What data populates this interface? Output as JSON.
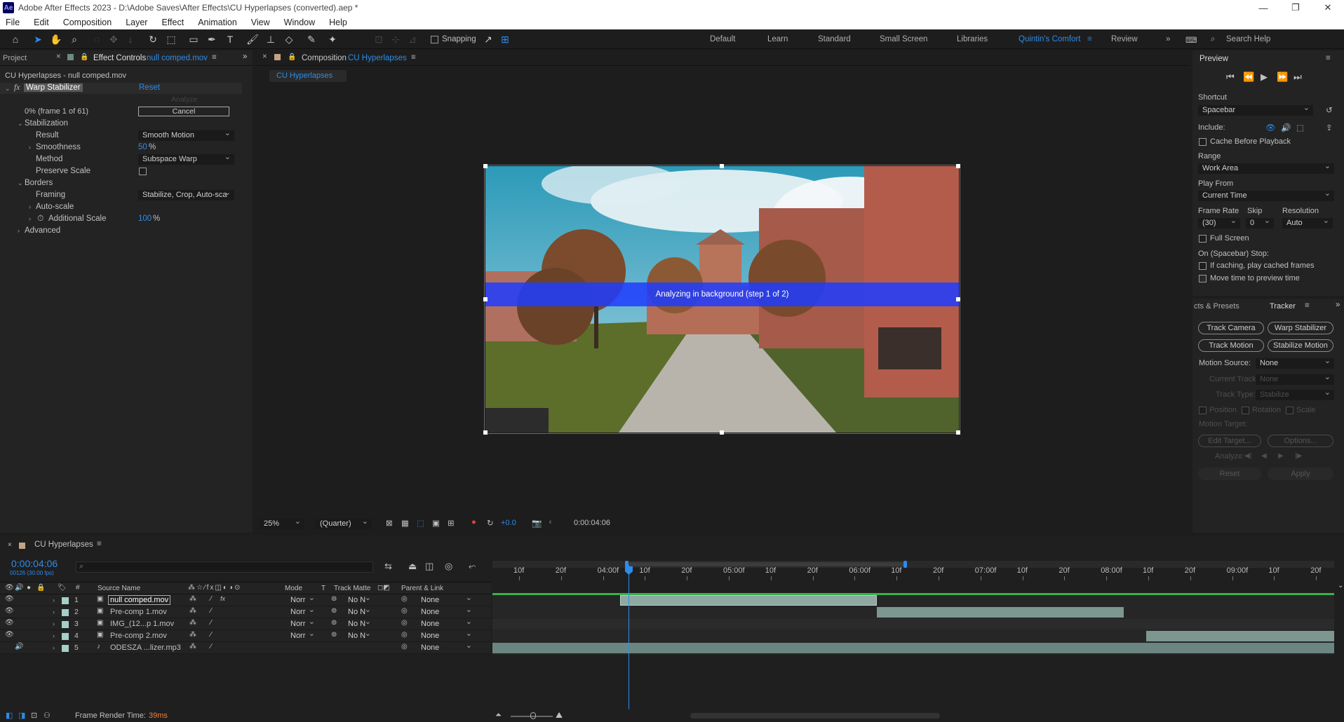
{
  "app": {
    "title": "Adobe After Effects 2023 - D:\\Adobe Saves\\After Effects\\CU Hyperlapses (converted).aep *",
    "logo": "Ae"
  },
  "menu": [
    "File",
    "Edit",
    "Composition",
    "Layer",
    "Effect",
    "Animation",
    "View",
    "Window",
    "Help"
  ],
  "toolbar": {
    "snapping": "Snapping"
  },
  "workspaces": [
    "Default",
    "Learn",
    "Standard",
    "Small Screen",
    "Libraries",
    "Quintin's Comfort",
    "Review"
  ],
  "active_workspace": "Quintin's Comfort",
  "search": {
    "placeholder": "Search Help"
  },
  "effect_panel": {
    "project_tab": "Project",
    "tab_label": "Effect Controls",
    "tab_layer": "null comped.mov",
    "breadcrumb": "CU Hyperlapses - null comped.mov",
    "effect_name": "Warp Stabilizer",
    "reset": "Reset",
    "analyze": "Analyze",
    "progress": "0% (frame 1 of 61)",
    "cancel": "Cancel",
    "stabilization": "Stabilization",
    "result_label": "Result",
    "result_value": "Smooth Motion",
    "smoothness_label": "Smoothness",
    "smoothness_value": "50",
    "smoothness_unit": "%",
    "method_label": "Method",
    "method_value": "Subspace Warp",
    "preserve_label": "Preserve Scale",
    "borders": "Borders",
    "framing_label": "Framing",
    "framing_value": "Stabilize, Crop, Auto-sca",
    "autoscale": "Auto-scale",
    "addscale_label": "Additional Scale",
    "addscale_value": "100",
    "addscale_unit": "%",
    "advanced": "Advanced"
  },
  "comp": {
    "tab_label": "Composition",
    "tab_name": "CU Hyperlapses",
    "subtab": "CU Hyperlapses",
    "overlay": "Analyzing in background (step 1 of 2)",
    "zoom": "25%",
    "resolution": "(Quarter)",
    "exposure": "+0.0",
    "timecode": "0:00:04:06"
  },
  "preview": {
    "title": "Preview",
    "shortcut_label": "Shortcut",
    "shortcut": "Spacebar",
    "include": "Include:",
    "cache": "Cache Before Playback",
    "range_label": "Range",
    "range": "Work Area",
    "playfrom_label": "Play From",
    "playfrom": "Current Time",
    "framerate_label": "Frame Rate",
    "skip_label": "Skip",
    "resolution_label": "Resolution",
    "framerate": "(30)",
    "skip": "0",
    "resolution": "Auto",
    "fullscreen": "Full Screen",
    "stop_label": "On (Spacebar) Stop:",
    "caching": "If caching, play cached frames",
    "movetime": "Move time to preview time"
  },
  "tracker": {
    "presets_tab": "cts & Presets",
    "tab": "Tracker",
    "track_camera": "Track Camera",
    "warp_stabilizer": "Warp Stabilizer",
    "track_motion": "Track Motion",
    "stabilize_motion": "Stabilize Motion",
    "motion_source_label": "Motion Source:",
    "motion_source": "None",
    "current_track_label": "Current Track:",
    "current_track": "None",
    "track_type_label": "Track Type:",
    "track_type": "Stabilize",
    "position": "Position",
    "rotation": "Rotation",
    "scale": "Scale",
    "motion_target": "Motion Target:",
    "edit_target": "Edit Target...",
    "options": "Options...",
    "analyze": "Analyze:",
    "reset": "Reset",
    "apply": "Apply"
  },
  "timeline": {
    "tab": "CU Hyperlapses",
    "timecode": "0:00:04:06",
    "fps": "00126 (30.00 fps)",
    "col_num": "#",
    "col_source": "Source Name",
    "col_mode": "Mode",
    "col_t": "T",
    "col_matte": "Track Matte",
    "col_parent": "Parent & Link",
    "layers": [
      {
        "num": "1",
        "name": "null comped.mov",
        "mode": "Norr",
        "matte": "No N",
        "parent": "None",
        "color": "#a5cfc7"
      },
      {
        "num": "2",
        "name": "Pre-comp 1.mov",
        "mode": "Norr",
        "matte": "No N",
        "parent": "None",
        "color": "#a5cfc7"
      },
      {
        "num": "3",
        "name": "IMG_(12...p 1.mov",
        "mode": "Norr",
        "matte": "No N",
        "parent": "None",
        "color": "#a5cfc7"
      },
      {
        "num": "4",
        "name": "Pre-comp 2.mov",
        "mode": "Norr",
        "matte": "No N",
        "parent": "None",
        "color": "#a5cfc7"
      },
      {
        "num": "5",
        "name": "ODESZA ...lizer.mp3",
        "mode": "",
        "matte": "",
        "parent": "None",
        "color": "#a5cfc7"
      }
    ],
    "ruler": [
      "10f",
      "20f",
      "04:00f",
      "10f",
      "20f",
      "05:00f",
      "10f",
      "20f",
      "06:00f",
      "10f",
      "20f",
      "07:00f",
      "10f",
      "20f",
      "08:00f",
      "10f",
      "20f",
      "09:00f",
      "10f",
      "20f"
    ],
    "render_label": "Frame Render Time:",
    "render_value": "39ms"
  }
}
